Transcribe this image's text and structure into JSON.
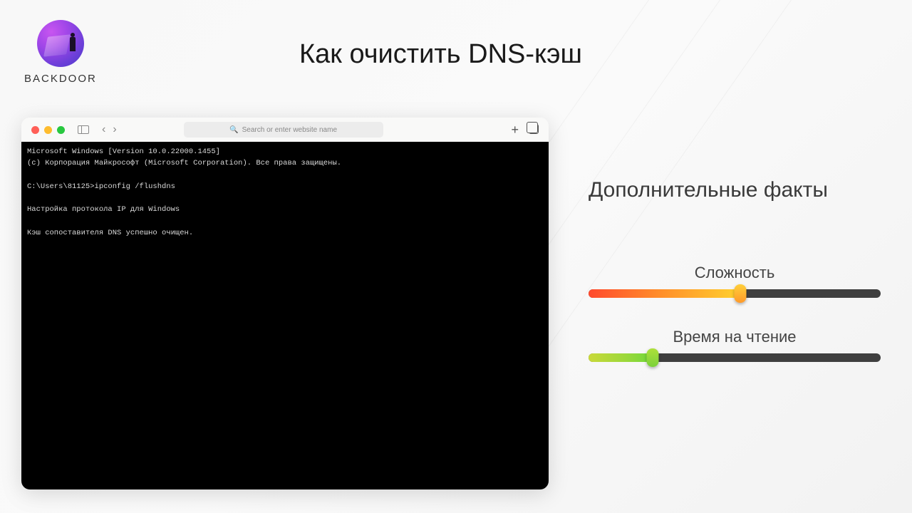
{
  "brand": {
    "name": "BACKDOOR"
  },
  "title": "Как очистить DNS-кэш",
  "browser": {
    "url_placeholder": "Search or enter website name",
    "terminal_lines": [
      "Microsoft Windows [Version 10.0.22000.1455]",
      "(c) Корпорация Майкрософт (Microsoft Corporation). Все права защищены.",
      "",
      "C:\\Users\\81125>ipconfig /flushdns",
      "",
      "Настройка протокола IP для Windows",
      "",
      "Кэш сопоставителя DNS успешно очищен."
    ]
  },
  "facts": {
    "heading": "Дополнительные факты",
    "sliders": [
      {
        "label": "Сложность",
        "percent": 52,
        "color": "orange"
      },
      {
        "label": "Время  на чтение",
        "percent": 22,
        "color": "green"
      }
    ]
  }
}
